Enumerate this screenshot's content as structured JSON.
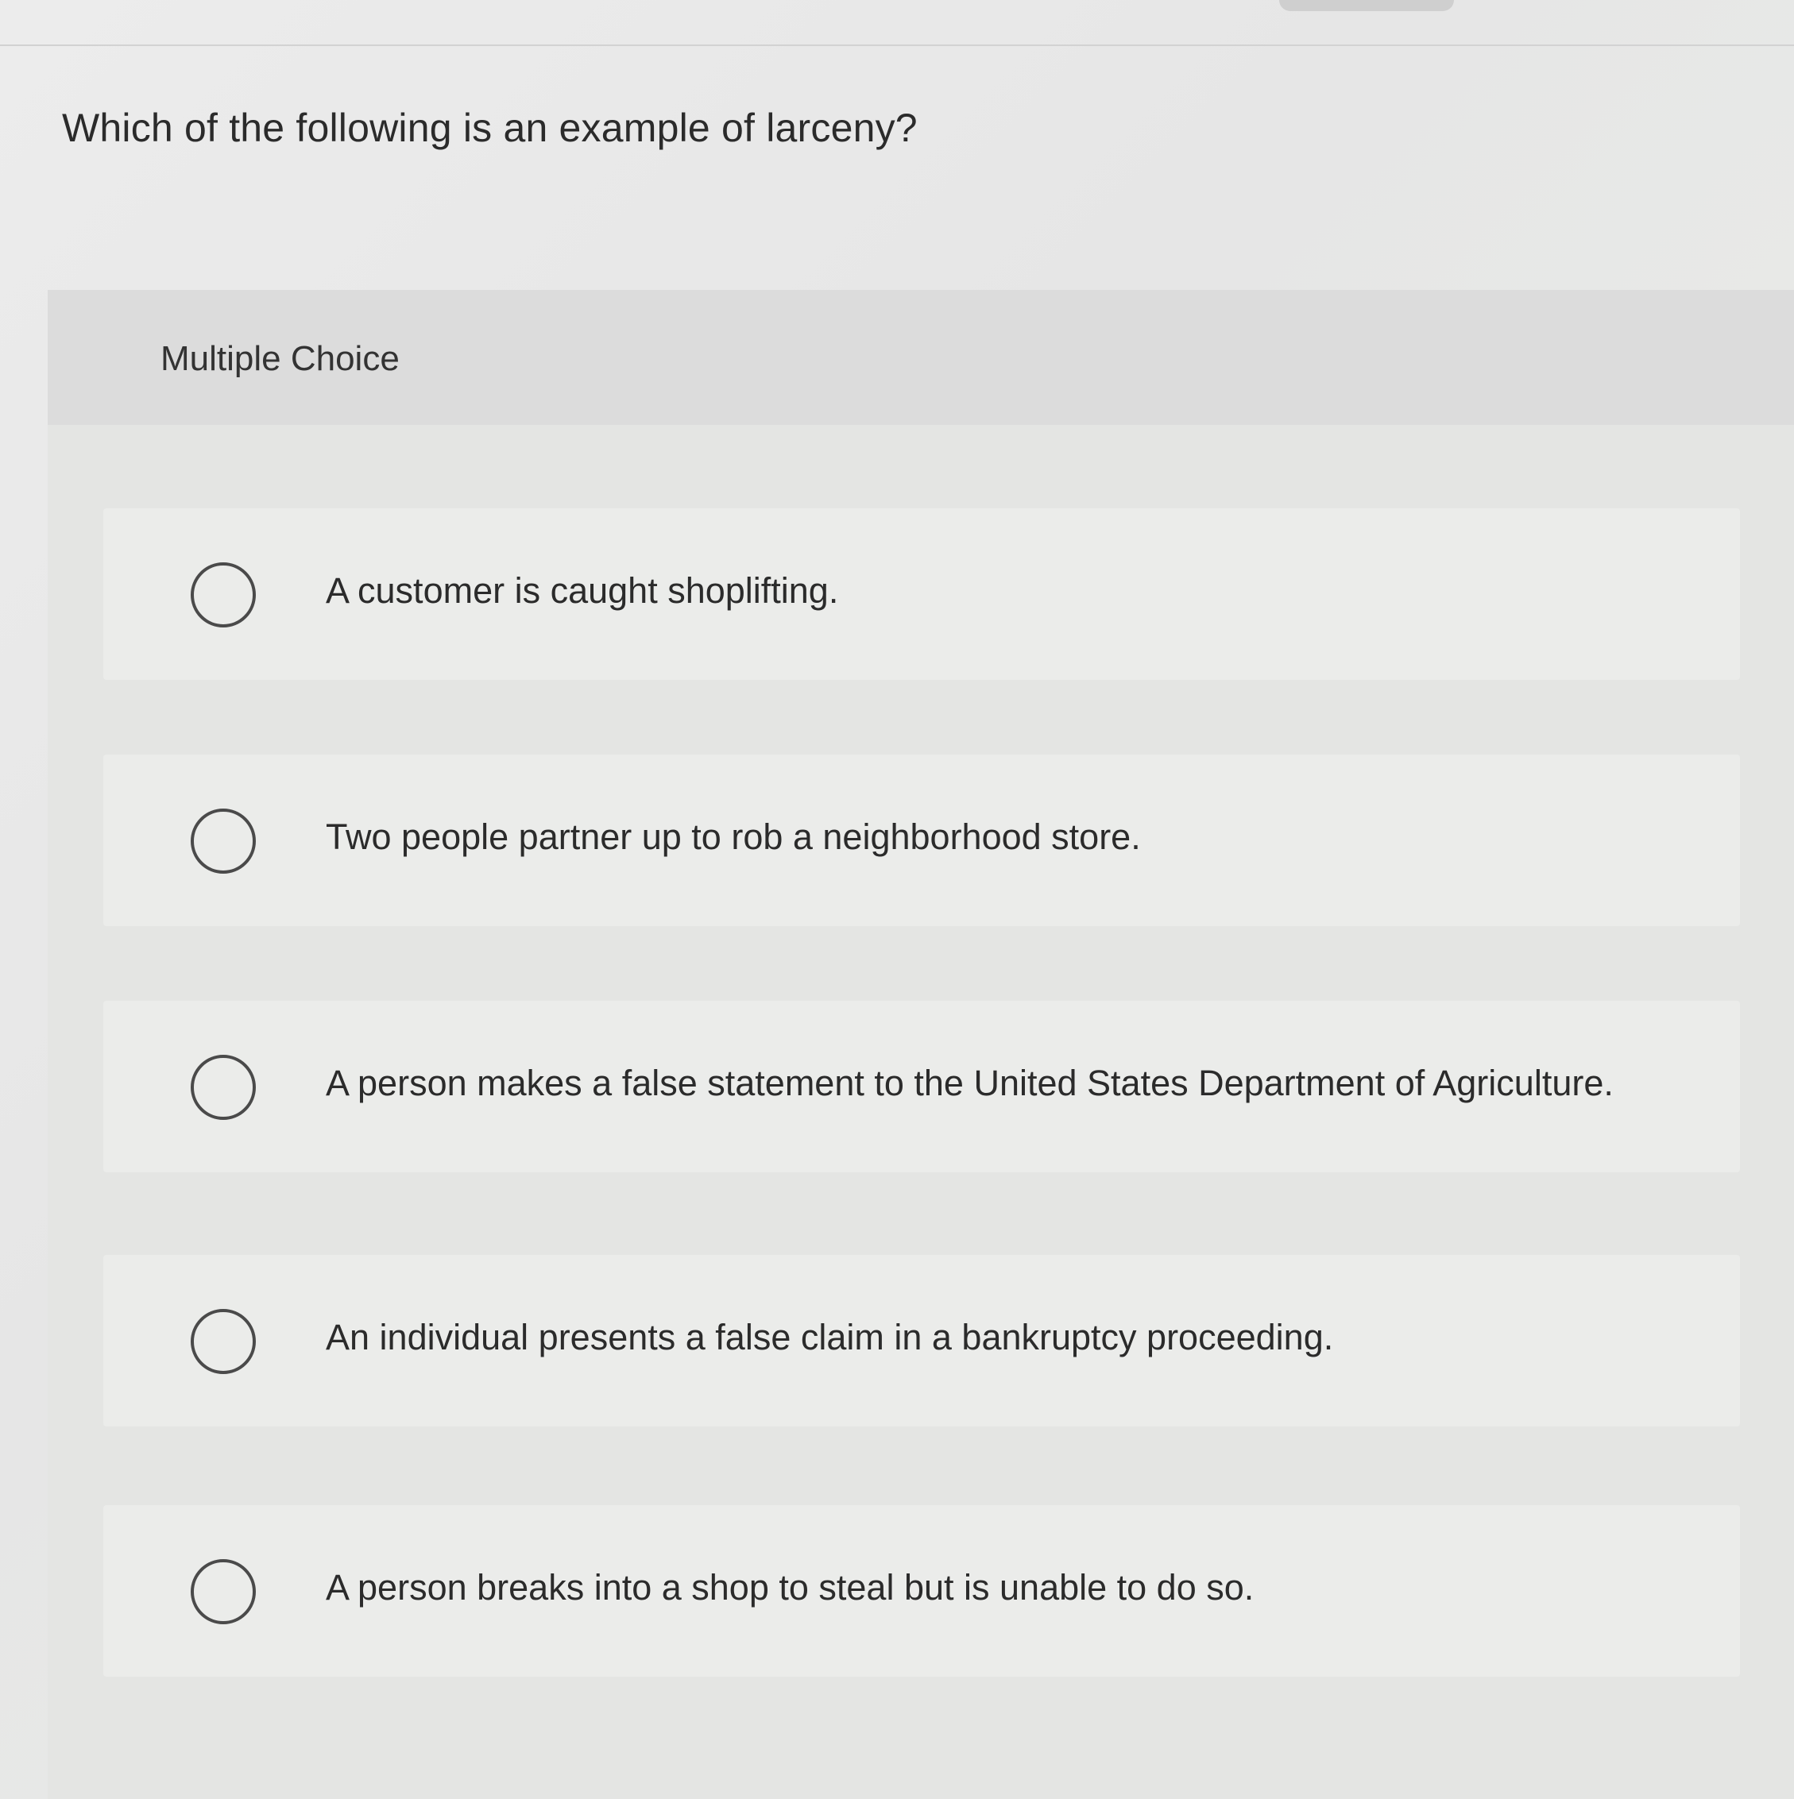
{
  "question": {
    "prompt": "Which of the following is an example of larceny?",
    "type_label": "Multiple Choice"
  },
  "choices": [
    {
      "label": "A customer is caught shoplifting.",
      "selected": false
    },
    {
      "label": "Two people partner up to rob a neighborhood store.",
      "selected": false
    },
    {
      "label": "A person makes a false statement to the United States Department of Agriculture.",
      "selected": false
    },
    {
      "label": "An individual presents a false claim in a bankruptcy proceeding.",
      "selected": false
    },
    {
      "label": "A person breaks into a shop to steal but is unable to do so.",
      "selected": false
    }
  ]
}
